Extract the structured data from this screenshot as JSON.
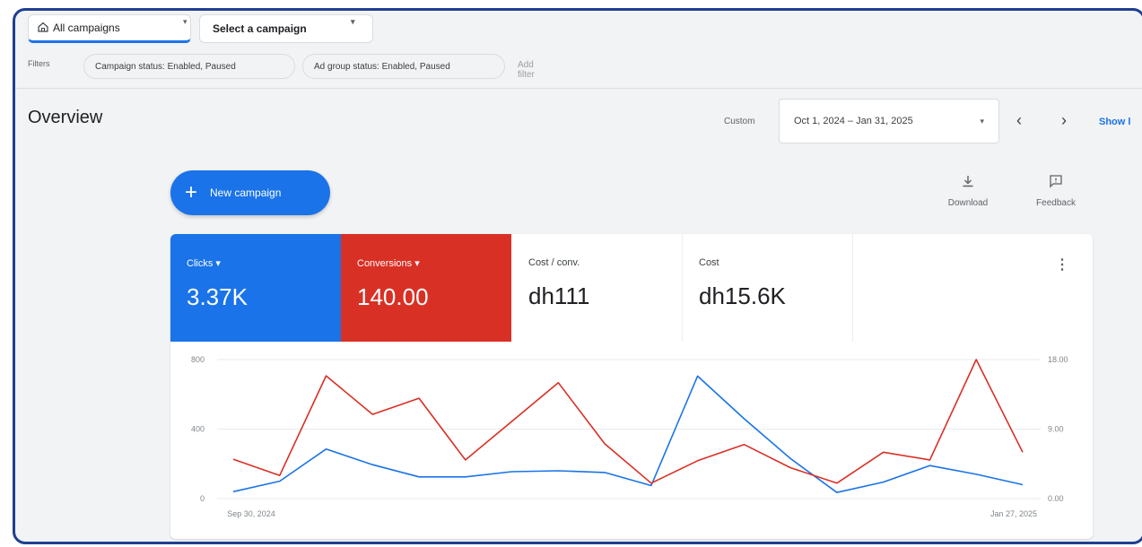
{
  "header": {
    "all_campaigns": "All campaigns",
    "select_campaign": "Select a campaign"
  },
  "filters": {
    "label": "Filters",
    "chips": [
      "Campaign status: Enabled, Paused",
      "Ad group status: Enabled, Paused"
    ],
    "add_filter": "Add filter"
  },
  "overview": {
    "title": "Overview",
    "custom": "Custom",
    "date_range": "Oct 1, 2024 – Jan 31, 2025",
    "show": "Show l"
  },
  "actions": {
    "new_campaign": "New campaign",
    "download": "Download",
    "feedback": "Feedback"
  },
  "metrics": [
    {
      "label": "Clicks",
      "value": "3.37K"
    },
    {
      "label": "Conversions",
      "value": "140.00"
    },
    {
      "label": "Cost / conv.",
      "value": "dh111"
    },
    {
      "label": "Cost",
      "value": "dh15.6K"
    }
  ],
  "colors": {
    "clicks": "#1a73e8",
    "conversions": "#d93025"
  },
  "chart_data": {
    "type": "line",
    "x": [
      "Sep 30, 2024",
      "",
      "",
      "",
      "",
      "",
      "",
      "",
      "",
      "",
      "",
      "",
      "",
      "",
      "",
      "",
      "",
      "Jan 27, 2025"
    ],
    "xtick_labels": [
      "Sep 30, 2024",
      "Jan 27, 2025"
    ],
    "left_axis": {
      "ticks": [
        "800",
        "400",
        "0"
      ],
      "ylim": [
        0,
        800
      ]
    },
    "right_axis": {
      "ticks": [
        "18.00",
        "9.00",
        "0.00"
      ],
      "ylim": [
        0,
        18
      ]
    },
    "series": [
      {
        "name": "Clicks",
        "axis": "left",
        "color": "#1a73e8",
        "values": [
          40,
          100,
          285,
          195,
          125,
          125,
          155,
          160,
          150,
          75,
          705,
          460,
          230,
          35,
          95,
          190,
          140,
          80
        ]
      },
      {
        "name": "Conversions",
        "axis": "right",
        "color": "#d93025",
        "values": [
          5.1,
          3.0,
          15.9,
          10.9,
          13.0,
          5.0,
          10.0,
          15.0,
          7.1,
          2.0,
          4.9,
          7.0,
          4.0,
          2.0,
          6.0,
          5.0,
          18.0,
          6.0
        ]
      }
    ],
    "grid": true
  }
}
